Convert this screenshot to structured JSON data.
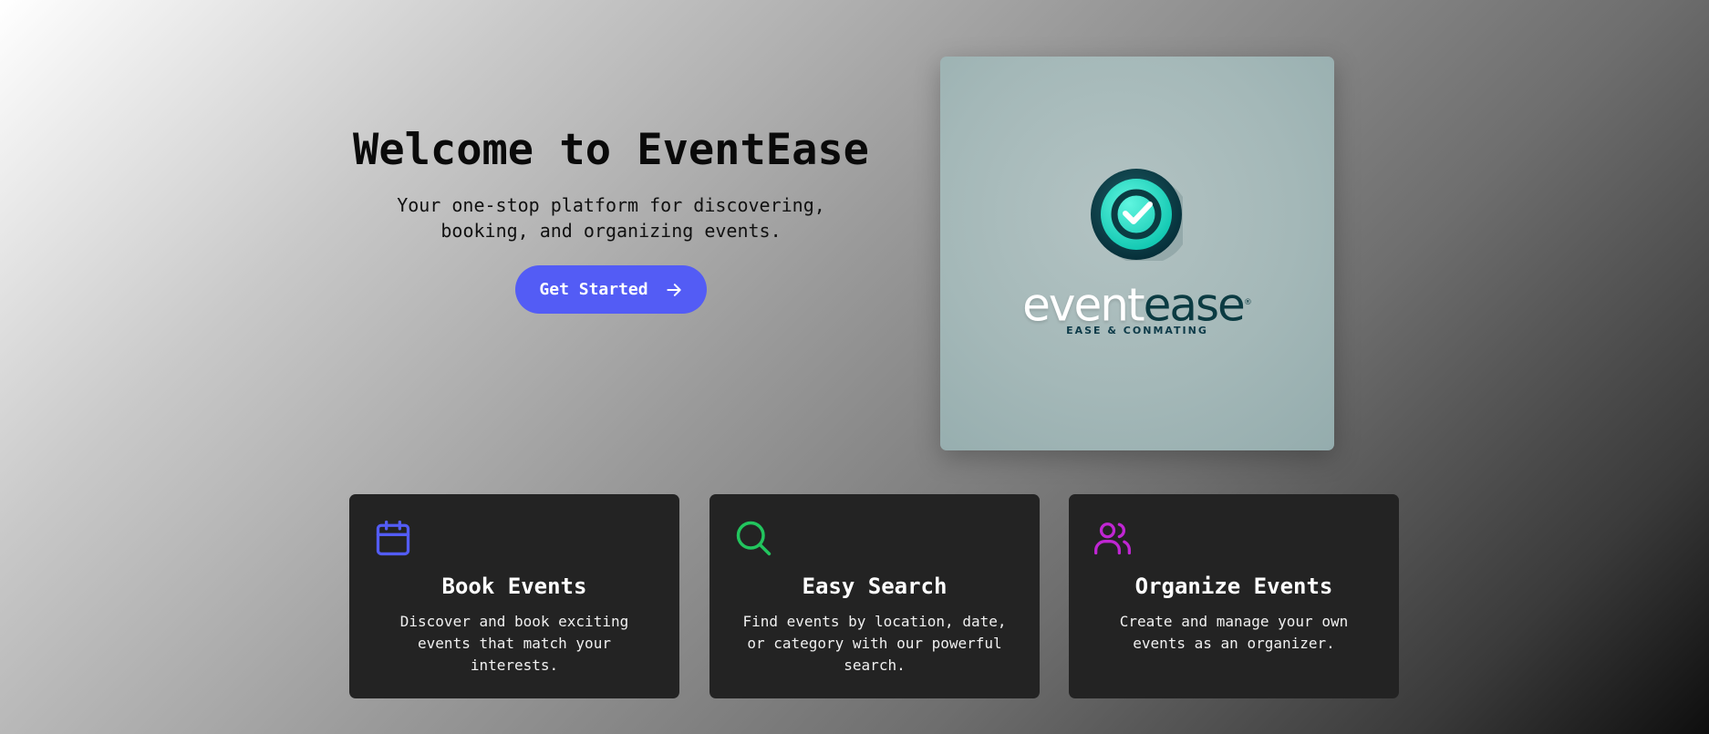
{
  "hero": {
    "title": "Welcome to EventEase",
    "subtitle": "Your one-stop platform for discovering, booking, and organizing events.",
    "cta_label": "Get Started",
    "cta_icon": "arrow-right-icon"
  },
  "logo": {
    "word_part1": "event",
    "word_part2": "ease",
    "registered": "®",
    "tagline": "EASE & CONMATING",
    "mark_icon": "check-badge-icon"
  },
  "features": [
    {
      "icon": "calendar-icon",
      "color": "#535cf5",
      "title": "Book Events",
      "description": "Discover and book exciting events that match your interests."
    },
    {
      "icon": "search-icon",
      "color": "#22c55e",
      "title": "Easy Search",
      "description": "Find events by location, date, or category with our powerful search."
    },
    {
      "icon": "users-icon",
      "color": "#c026d3",
      "title": "Organize Events",
      "description": "Create and manage your own events as an organizer."
    }
  ],
  "colors": {
    "accent": "#535cf5",
    "card_bg": "#232323",
    "logo_teal": "#1de9c8"
  }
}
